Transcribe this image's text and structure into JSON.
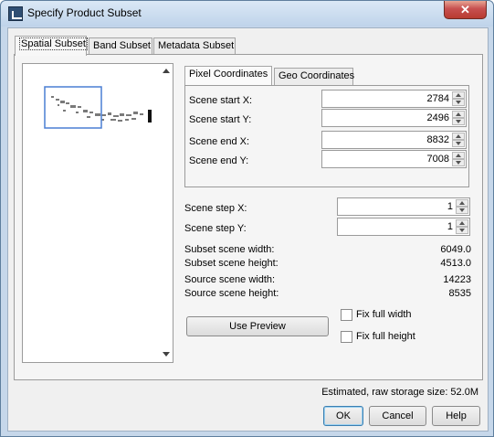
{
  "window": {
    "title": "Specify Product Subset",
    "close_label": "✕"
  },
  "tabs": [
    {
      "label": "Spatial Subset"
    },
    {
      "label": "Band Subset"
    },
    {
      "label": "Metadata Subset"
    }
  ],
  "coord_tabs": [
    {
      "label": "Pixel Coordinates"
    },
    {
      "label": "Geo Coordinates"
    }
  ],
  "fields": {
    "start_x": {
      "label": "Scene start X:",
      "value": "2784"
    },
    "start_y": {
      "label": "Scene start Y:",
      "value": "2496"
    },
    "end_x": {
      "label": "Scene end X:",
      "value": "8832"
    },
    "end_y": {
      "label": "Scene end Y:",
      "value": "7008"
    },
    "step_x": {
      "label": "Scene step X:",
      "value": "1"
    },
    "step_y": {
      "label": "Scene step Y:",
      "value": "1"
    }
  },
  "info": {
    "subset_width": {
      "label": "Subset scene width:",
      "value": "6049.0"
    },
    "subset_height": {
      "label": "Subset scene height:",
      "value": "4513.0"
    },
    "source_width": {
      "label": "Source scene width:",
      "value": "14223"
    },
    "source_height": {
      "label": "Source scene height:",
      "value": "8535"
    }
  },
  "buttons": {
    "use_preview": "Use Preview",
    "ok": "OK",
    "cancel": "Cancel",
    "help": "Help"
  },
  "checkboxes": {
    "fix_width": {
      "label": "Fix full width",
      "checked": false
    },
    "fix_height": {
      "label": "Fix full height",
      "checked": false
    }
  },
  "storage_text": "Estimated, raw storage size: 52.0M",
  "colors": {
    "selection_rect": "#4a7fd4",
    "title_bg": "#c6d7ea"
  }
}
